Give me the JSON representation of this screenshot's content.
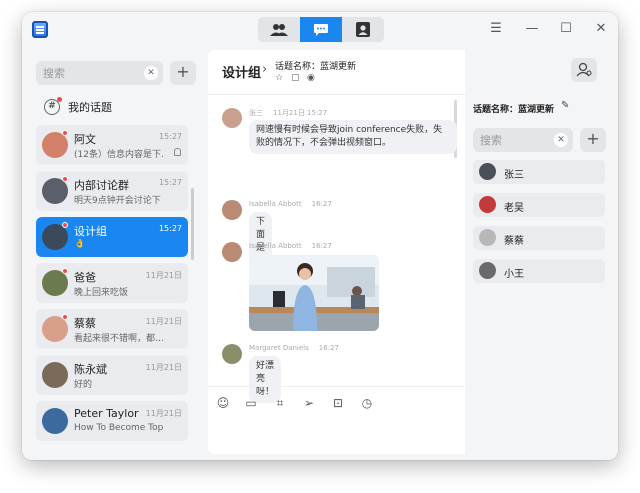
{
  "header": {
    "tabs": [
      {
        "name": "contacts-group",
        "icon": "people-icon",
        "active": false
      },
      {
        "name": "chat",
        "icon": "chat-bubble-icon",
        "active": true
      },
      {
        "name": "address-book",
        "icon": "contact-card-icon",
        "active": false
      }
    ],
    "controls": {
      "menu": "☰",
      "minimize": "—",
      "maximize": "☐",
      "close": "✕"
    }
  },
  "sidebar": {
    "search_placeholder": "搜索",
    "my_topics_label": "我的话题",
    "conversations": [
      {
        "name": "阿文",
        "time": "15:27",
        "preview": "(12条）信息内容是下...",
        "muted": true,
        "unread": true,
        "avatar_color": "#d2806a"
      },
      {
        "name": "内部讨论群",
        "time": "15:27",
        "preview": "明天9点钟开会讨论下",
        "muted": false,
        "unread": true,
        "avatar_color": "#5a5f6a"
      },
      {
        "name": "设计组",
        "time": "15:27",
        "preview": "👌",
        "muted": false,
        "unread": true,
        "active": true,
        "avatar_color": "#3a4a5a"
      },
      {
        "name": "爸爸",
        "time": "11月21日",
        "preview": "晚上回来吃饭",
        "muted": false,
        "unread": true,
        "avatar_color": "#6b7a4f"
      },
      {
        "name": "蔡蔡",
        "time": "11月21日",
        "preview": "看起来很不错啊，都…",
        "muted": false,
        "unread": true,
        "avatar_color": "#d8a08a"
      },
      {
        "name": "陈永斌",
        "time": "11月21日",
        "preview": "好的",
        "muted": false,
        "unread": false,
        "avatar_color": "#7a6a5a"
      },
      {
        "name": "Peter Taylor",
        "time": "11月21日",
        "preview": "How To Become Top...",
        "muted": false,
        "unread": false,
        "avatar_color": "#3a6aa0"
      }
    ]
  },
  "chat": {
    "title": "设计组",
    "topic": "话题名称：蓝湖更新",
    "messages": [
      {
        "sender": "张三",
        "time": "11月21日 15:27",
        "text": "网速慢有时候会导致join conference失败，失败的情况下，不会弹出视频窗口。",
        "type": "text",
        "avatar_color": "#c9a08e"
      },
      {
        "sender": "Isabella Abbott",
        "time": "16:27",
        "text": "下面是图片",
        "type": "text",
        "avatar_color": "#b98a74"
      },
      {
        "sender": "Isabella Abbott",
        "time": "16:27",
        "text": "",
        "type": "image",
        "avatar_color": "#b98a74"
      },
      {
        "sender": "Margaret Daniels",
        "time": "16:27",
        "text": "好漂亮呀！",
        "type": "text",
        "avatar_color": "#8a8f6a"
      }
    ],
    "composer_tools": [
      "emoji-icon",
      "folder-icon",
      "crop-icon",
      "send-plane-icon",
      "screenshot-icon",
      "clock-icon"
    ]
  },
  "topic_panel": {
    "topic_label": "话题名称：蓝湖更新",
    "search_placeholder": "搜索",
    "members": [
      {
        "name": "张三",
        "avatar_color": "#4a5058"
      },
      {
        "name": "老吴",
        "avatar_color": "#c23a3a"
      },
      {
        "name": "蔡蔡",
        "avatar_color": "#b8b8b8"
      },
      {
        "name": "小王",
        "avatar_color": "#6a6a6a"
      }
    ]
  },
  "colors": {
    "accent": "#1a87f0",
    "unread_dot": "#f04b4b"
  }
}
